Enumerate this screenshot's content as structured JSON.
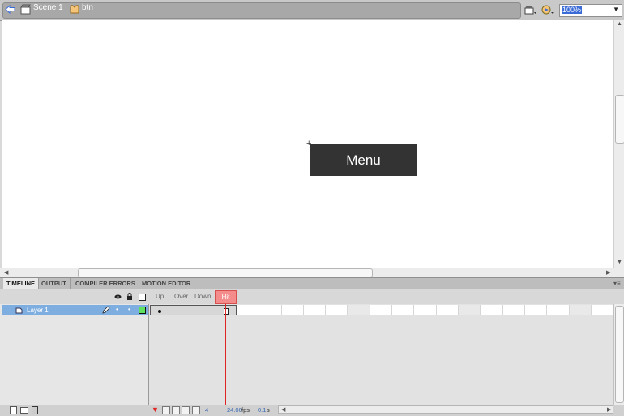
{
  "editbar": {
    "scene_label": "Scene 1",
    "symbol_label": "btn",
    "zoom": "100%"
  },
  "stage": {
    "button_text": "Menu",
    "background": "#ffffff",
    "button_color": "#333333"
  },
  "panel_tabs": [
    "TIMELINE",
    "OUTPUT",
    "COMPILER ERRORS",
    "MOTION EDITOR"
  ],
  "timeline": {
    "frame_labels": [
      "Up",
      "Over",
      "Down",
      "Hit"
    ],
    "current_frame_label": "Hit",
    "layer_name": "Layer 1",
    "current_frame": "4",
    "fps_value": "24.00",
    "fps_unit": "fps",
    "time_value": "0.1",
    "time_unit": "s"
  },
  "colors": {
    "accent": "#7eaee0",
    "playhead": "#e02424",
    "hit_frame": "#f48c8c"
  },
  "icons": [
    "back-arrow-icon",
    "scene-icon",
    "symbol-icon",
    "edit-scene-icon",
    "edit-symbol-icon",
    "eye-icon",
    "lock-icon",
    "outline-icon",
    "pencil-icon",
    "new-layer-icon",
    "new-folder-icon",
    "trash-icon",
    "onion-skin-icon"
  ]
}
